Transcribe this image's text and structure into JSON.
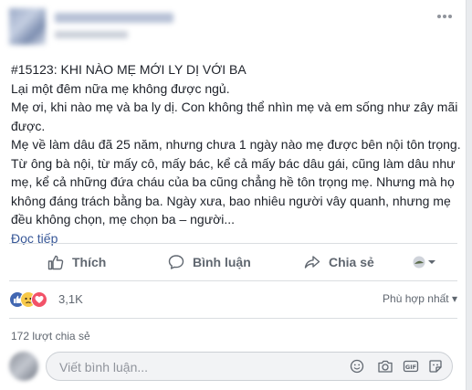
{
  "post": {
    "title": "#15123: KHI NÀO MẸ MỚI LY DỊ VỚI BA",
    "lines": [
      "Lại một đêm nữa mẹ không được ngủ.",
      "Mẹ ơi, khi nào mẹ và ba ly dị. Con không thể nhìn mẹ và em sống như zây mãi được.",
      "Mẹ về làm dâu đã 25 năm, nhưng chưa 1 ngày nào mẹ được bên nội tôn trọng. Từ ông bà nội, từ mấy cô, mấy bác, kể cả mấy bác dâu gái, cũng làm dâu như mẹ, kể cả những đứa cháu của ba cũng chẳng hề tôn trọng mẹ. Nhưng mà họ không đáng trách bằng ba. Ngày xưa, bao nhiêu người vây quanh, nhưng mẹ đều không chọn, mẹ chọn ba – người..."
    ],
    "read_more": "Đọc tiếp"
  },
  "actions": {
    "like": "Thích",
    "comment": "Bình luận",
    "share": "Chia sẻ"
  },
  "reactions": {
    "count": "3,1K",
    "sort": "Phù hợp nhất ▾"
  },
  "shares_text": "172 lượt chia sẻ",
  "comment_box": {
    "placeholder": "Viết bình luận..."
  },
  "colors": {
    "link": "#385898",
    "like_blue": "#4267b2",
    "sad_yellow": "#f7c94a",
    "love_red": "#f25268"
  },
  "icons": [
    "more-options-icon",
    "like-icon",
    "comment-icon",
    "share-icon",
    "profile-selector-icon",
    "emoji-icon",
    "camera-icon",
    "gif-icon",
    "sticker-icon"
  ]
}
